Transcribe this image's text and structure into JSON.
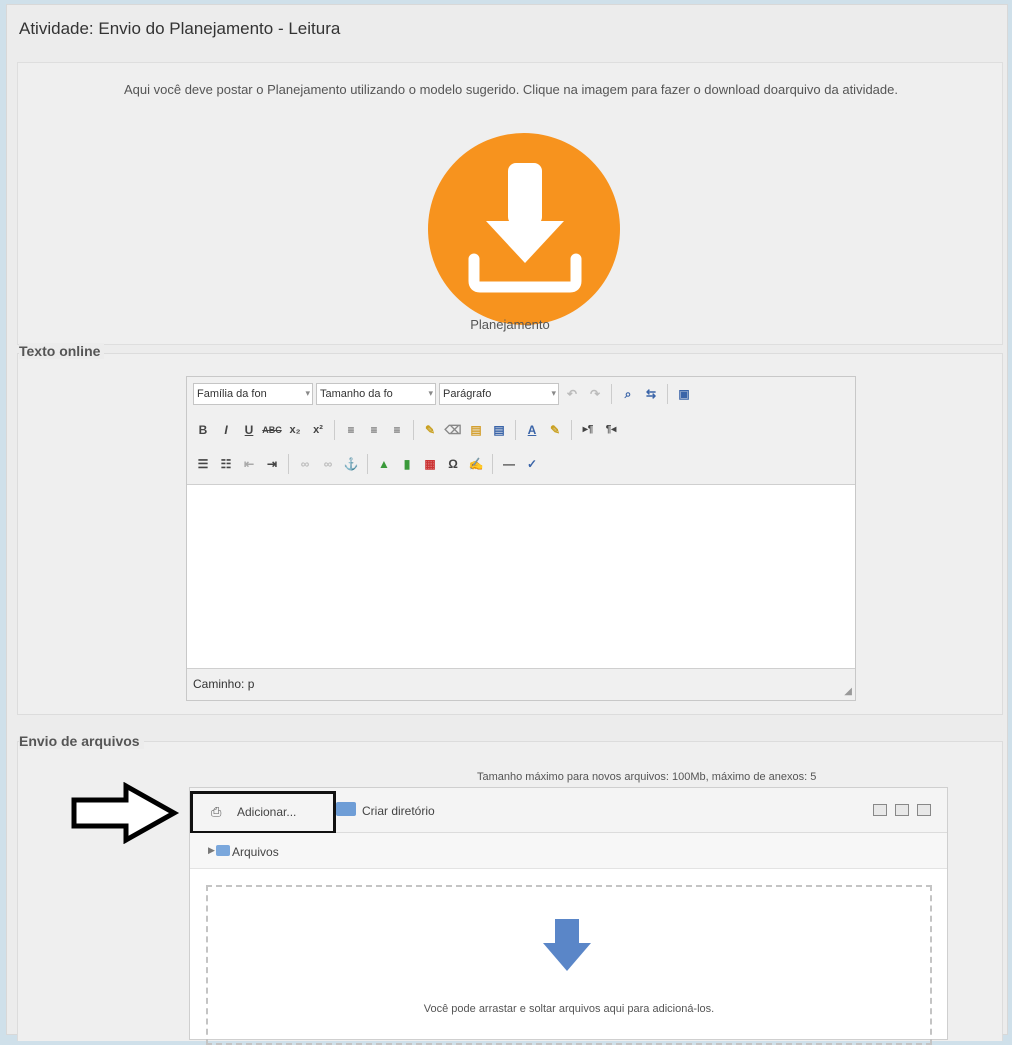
{
  "page": {
    "title": "Atividade: Envio do Planejamento - Leitura"
  },
  "intro": {
    "text": "Aqui você deve postar o Planejamento utilizando o modelo sugerido. Clique na imagem para fazer o download doarquivo da atividade.",
    "download_label": "Planejamento",
    "download_color": "#f7931e"
  },
  "online_text": {
    "legend": "Texto online",
    "toolbar": {
      "font_family": "Família da fon",
      "font_size": "Tamanho da fo",
      "paragraph": "Parágrafo",
      "row2": [
        "B",
        "I",
        "U",
        "ABC",
        "x₂",
        "x²"
      ],
      "symbol": "Ω",
      "text_color": "A"
    },
    "status_path": "Caminho: p"
  },
  "file_upload": {
    "legend": "Envio de arquivos",
    "max_size": "Tamanho máximo para novos arquivos: 100Mb, máximo de anexos: 5",
    "add_button": "Adicionar...",
    "mkdir_button": "Criar diretório",
    "path_folder": "Arquivos",
    "drop_text": "Você pode arrastar e soltar arquivos aqui para adicioná-los.",
    "drop_arrow_color": "#5a86c8"
  }
}
